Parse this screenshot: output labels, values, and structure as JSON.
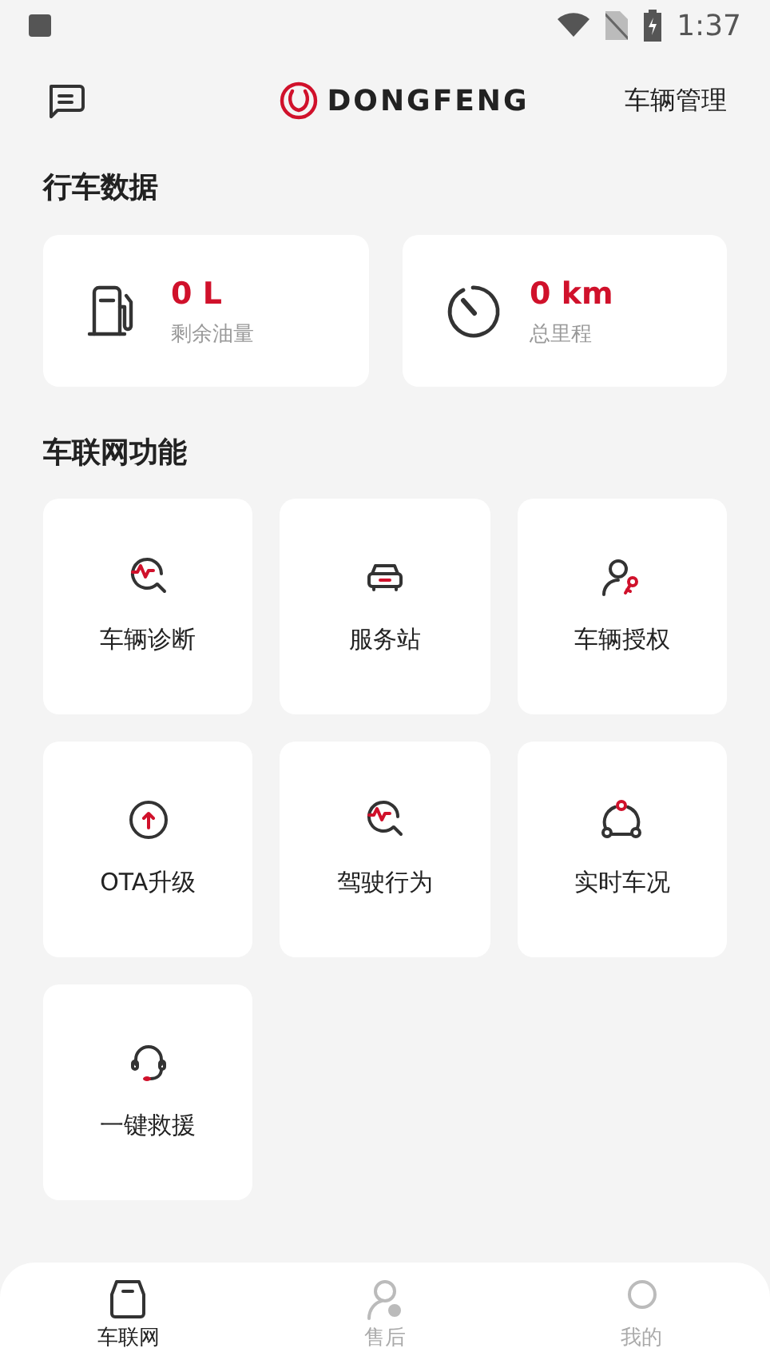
{
  "status_bar": {
    "time": "1:37"
  },
  "header": {
    "brand": "DONGFENG",
    "action": "车辆管理"
  },
  "driving_data": {
    "title": "行车数据",
    "stats": [
      {
        "value": "0 L",
        "label": "剩余油量"
      },
      {
        "value": "0 km",
        "label": "总里程"
      }
    ]
  },
  "features": {
    "title": "车联网功能",
    "items": [
      {
        "label": "车辆诊断"
      },
      {
        "label": "服务站"
      },
      {
        "label": "车辆授权"
      },
      {
        "label": "OTA升级"
      },
      {
        "label": "驾驶行为"
      },
      {
        "label": "实时车况"
      },
      {
        "label": "一键救援"
      }
    ]
  },
  "tab_bar": [
    {
      "label": "车联网",
      "selected": true
    },
    {
      "label": "售后",
      "selected": false
    },
    {
      "label": "我的",
      "selected": false
    }
  ]
}
